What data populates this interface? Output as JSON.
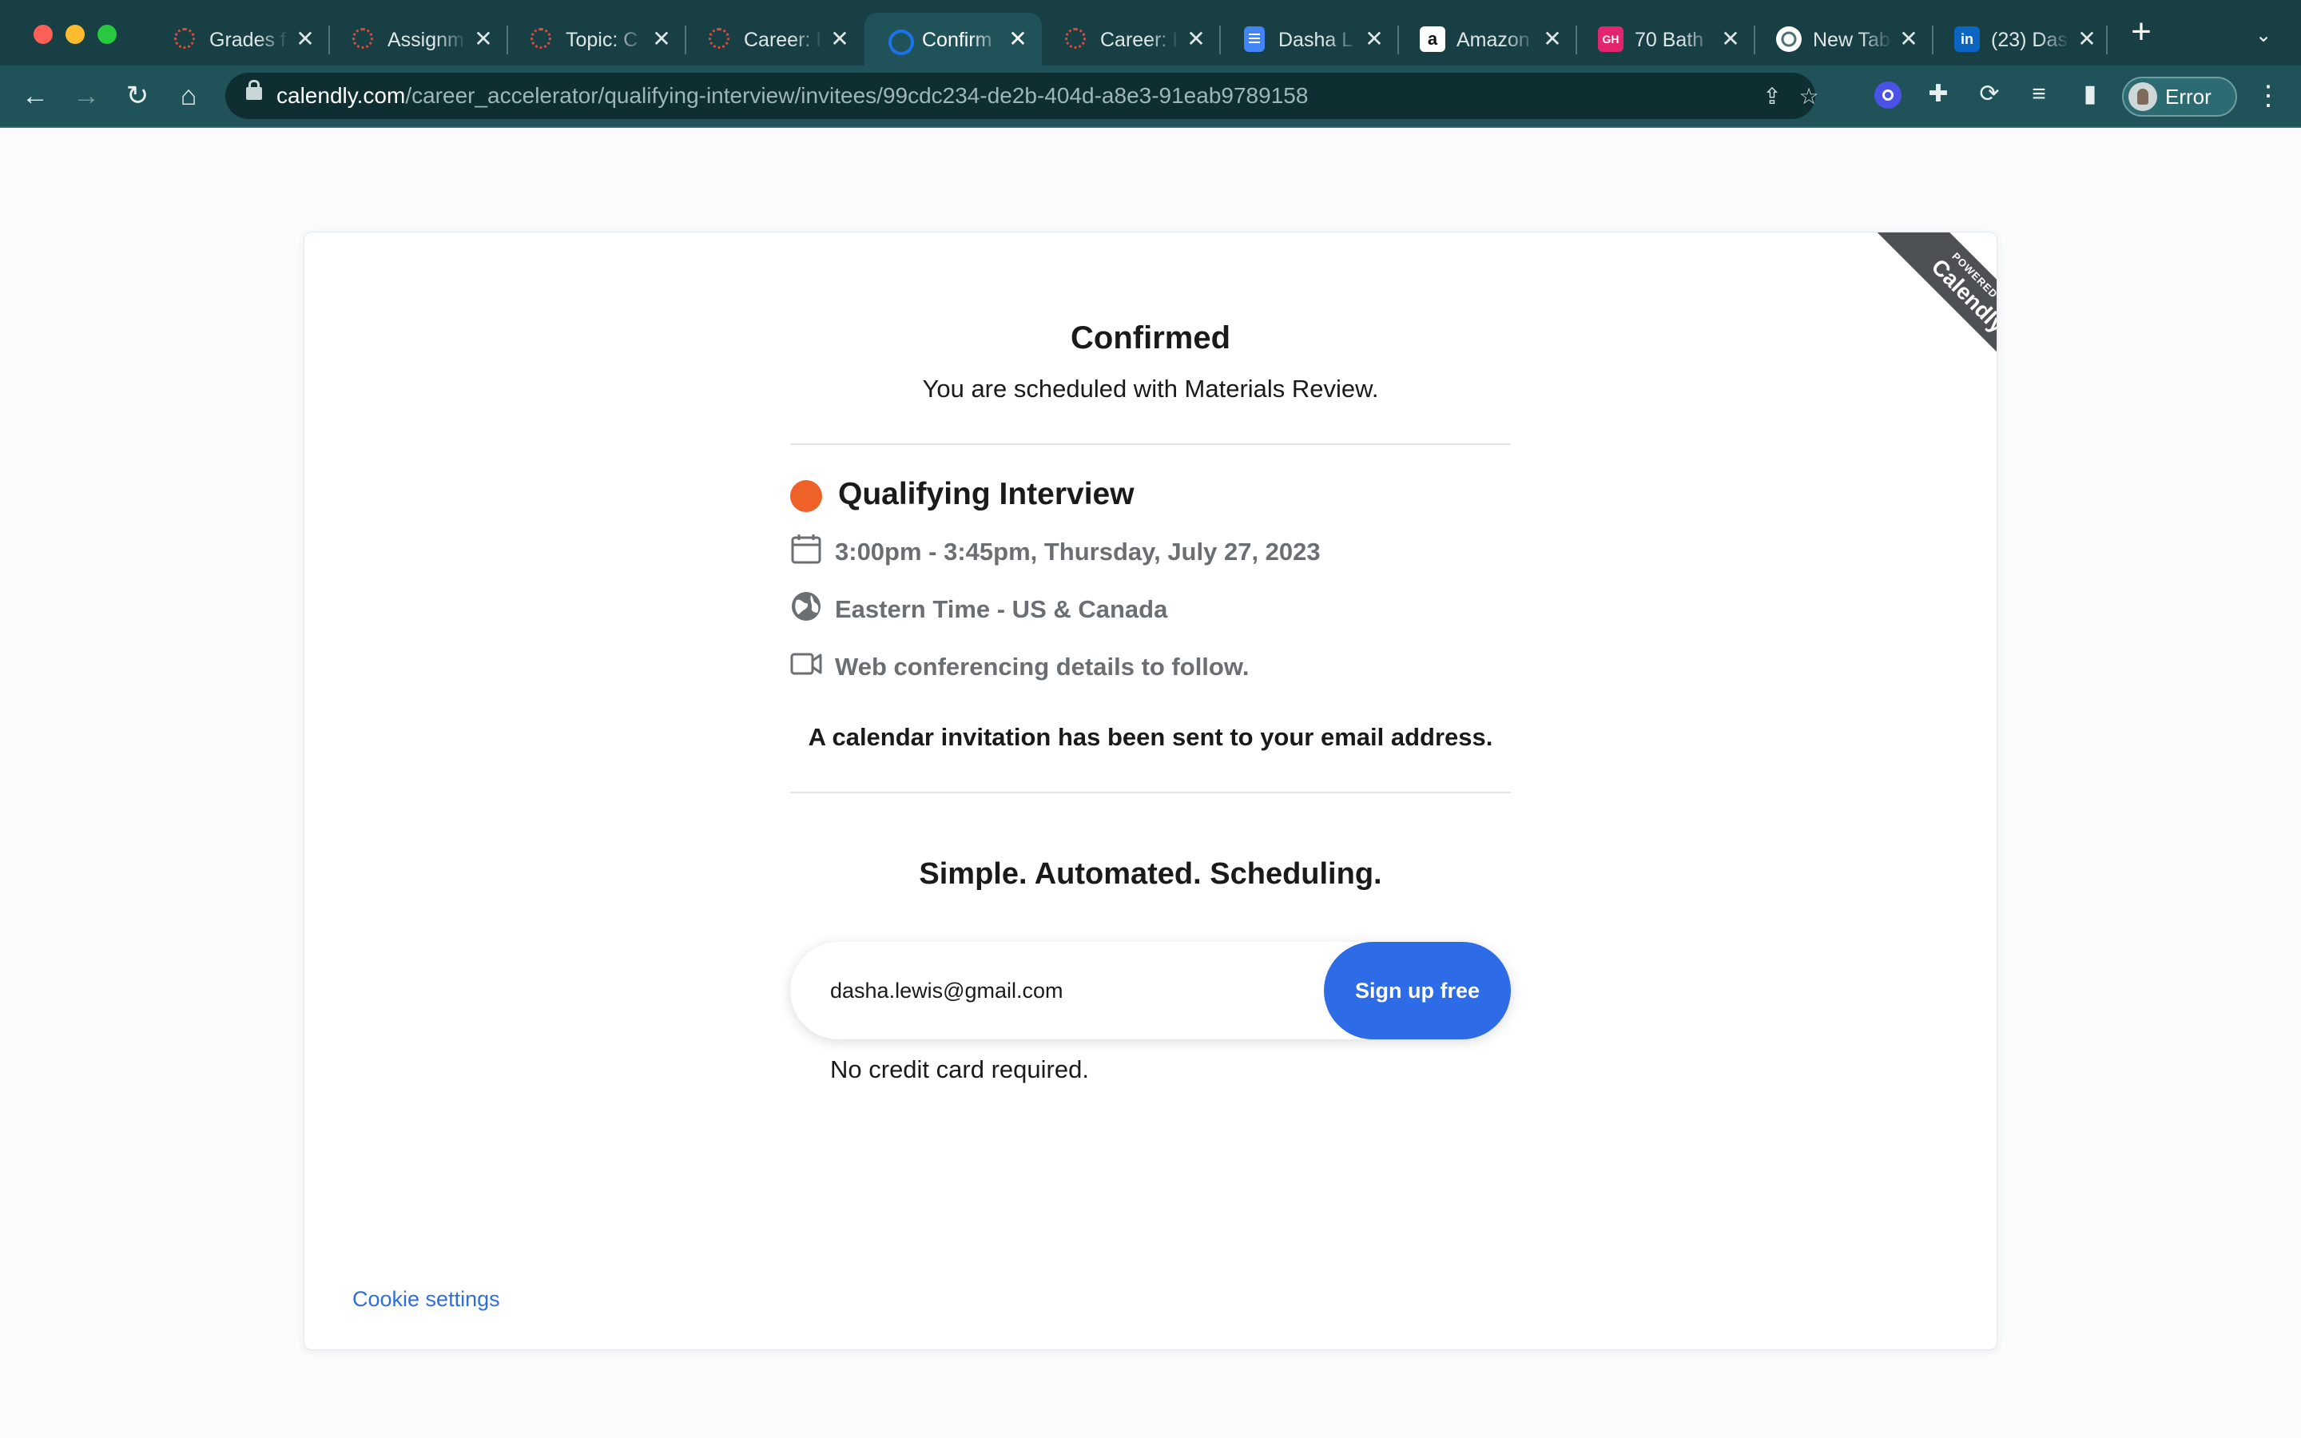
{
  "browser": {
    "tabs": [
      {
        "title": "Grades f",
        "favicon": "canvas-icon"
      },
      {
        "title": "Assignm",
        "favicon": "canvas-icon"
      },
      {
        "title": "Topic: C",
        "favicon": "canvas-icon"
      },
      {
        "title": "Career: I",
        "favicon": "canvas-icon"
      },
      {
        "title": "Confirm",
        "favicon": "calendly-icon",
        "active": true
      },
      {
        "title": "Career: I",
        "favicon": "canvas-icon"
      },
      {
        "title": "Dasha L",
        "favicon": "google-docs-icon"
      },
      {
        "title": "Amazon",
        "favicon": "amazon-icon",
        "glyph": "a"
      },
      {
        "title": "70 Bath",
        "favicon": "gh-icon",
        "glyph": "GH"
      },
      {
        "title": "New Tab",
        "favicon": "chrome-icon"
      },
      {
        "title": "(23) Das",
        "favicon": "linkedin-icon",
        "glyph": "in"
      }
    ],
    "tab_close_glyph": "✕",
    "new_tab_glyph": "+",
    "url_host": "calendly.com",
    "url_path": "/career_accelerator/qualifying-interview/invitees/99cdc234-de2b-404d-a8e3-91eab9789158",
    "profile_status": "Error"
  },
  "ribbon": {
    "small": "POWERED BY",
    "brand": "Calendly"
  },
  "confirmation": {
    "title": "Confirmed",
    "subtitle": "You are scheduled with Materials Review.",
    "event_name": "Qualifying Interview",
    "event_color": "#ee6128",
    "datetime": "3:00pm - 3:45pm, Thursday, July 27, 2023",
    "timezone": "Eastern Time - US & Canada",
    "location": "Web conferencing details to follow.",
    "invite_note": "A calendar invitation has been sent to your email address."
  },
  "promo": {
    "heading": "Simple. Automated. Scheduling.",
    "email_value": "dasha.lewis@gmail.com",
    "button_label": "Sign up free",
    "footnote": "No credit card required."
  },
  "footer": {
    "cookie_settings": "Cookie settings"
  },
  "colors": {
    "tabbar": "#173f44",
    "toolbar": "#1f5259",
    "primary_button": "#2d6ce6",
    "link": "#2f6fd6"
  }
}
